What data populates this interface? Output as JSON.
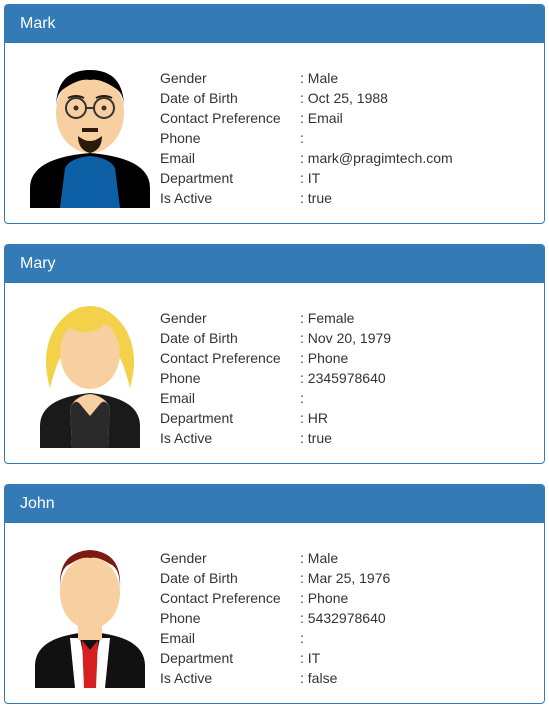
{
  "labels": {
    "gender": "Gender",
    "dob": "Date of Birth",
    "contactPref": "Contact Preference",
    "phone": "Phone",
    "email": "Email",
    "department": "Department",
    "isActive": "Is Active"
  },
  "employees": [
    {
      "name": "Mark",
      "avatar": "mark",
      "gender": "Male",
      "dob": "Oct 25, 1988",
      "contactPref": "Email",
      "phone": "",
      "email": "mark@pragimtech.com",
      "department": "IT",
      "isActive": "true"
    },
    {
      "name": "Mary",
      "avatar": "mary",
      "gender": "Female",
      "dob": "Nov 20, 1979",
      "contactPref": "Phone",
      "phone": "2345978640",
      "email": "",
      "department": "HR",
      "isActive": "true"
    },
    {
      "name": "John",
      "avatar": "john",
      "gender": "Male",
      "dob": "Mar 25, 1976",
      "contactPref": "Phone",
      "phone": "5432978640",
      "email": "",
      "department": "IT",
      "isActive": "false"
    }
  ]
}
